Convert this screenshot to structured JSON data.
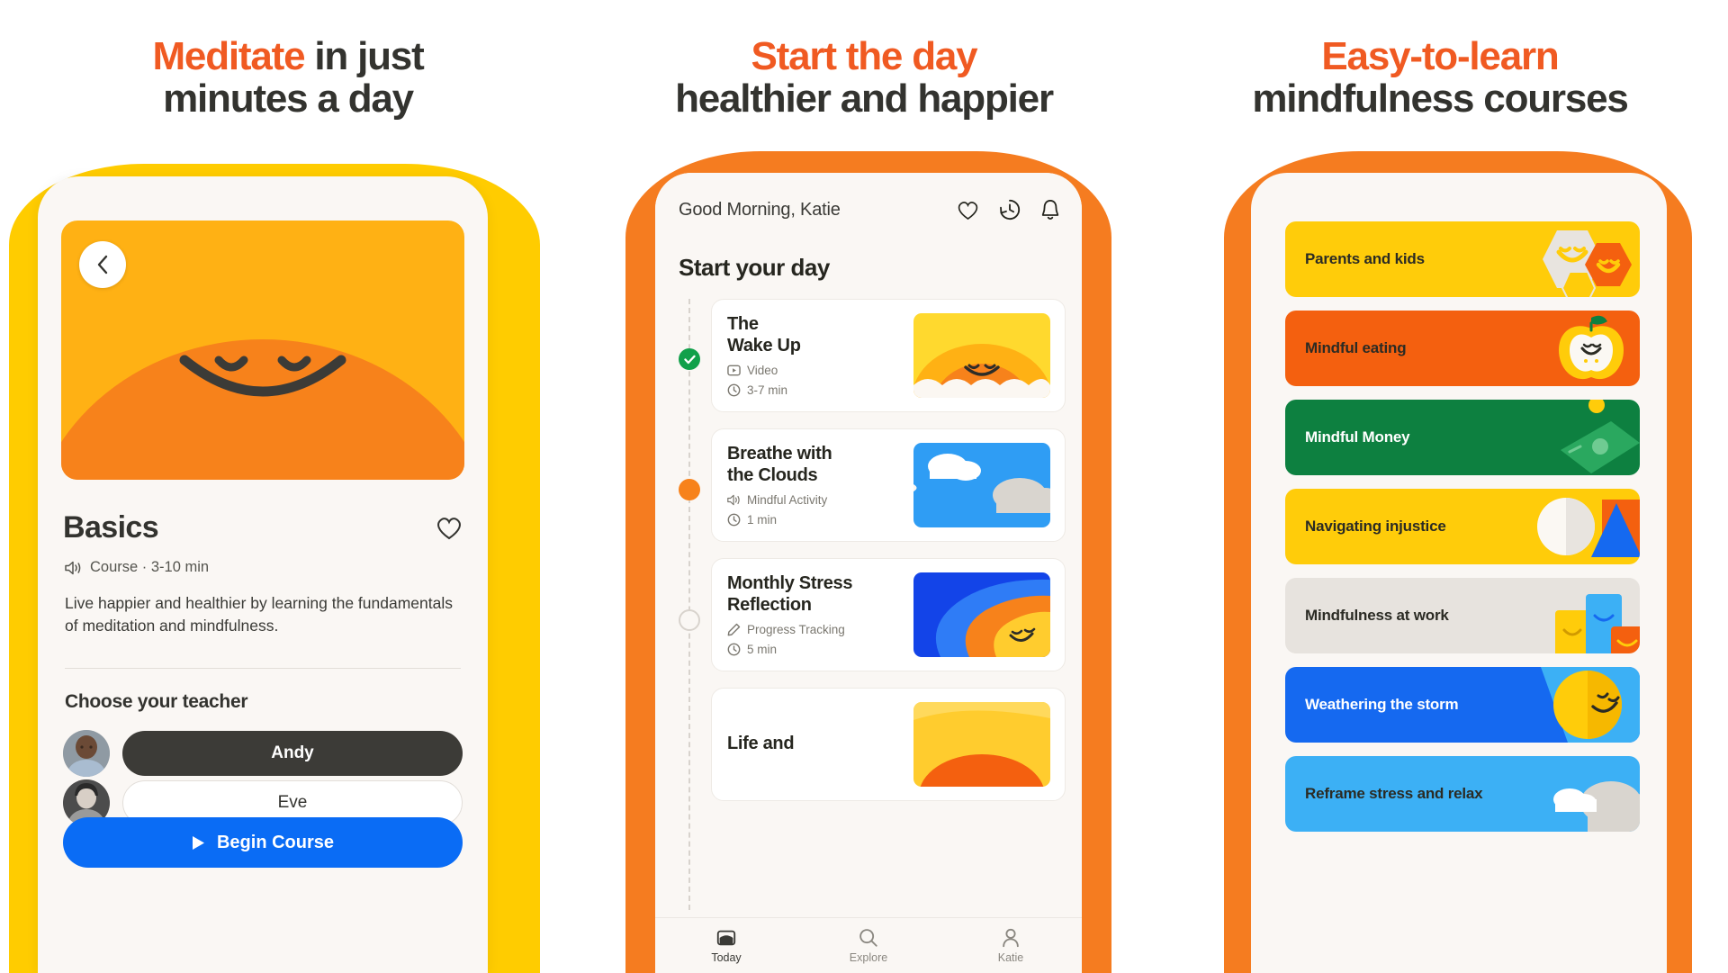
{
  "panels": [
    {
      "headline": {
        "accent": "Meditate",
        "rest": " in just",
        "line2": "minutes a day"
      },
      "app": {
        "back_icon": "chevron-left-icon",
        "course_title": "Basics",
        "favorite_icon": "heart-icon",
        "meta_icon": "speaker-icon",
        "meta": "Course · 3-10 min",
        "description": "Live happier and healthier by learning the fundamentals of meditation and mindfulness.",
        "teacher_heading": "Choose your teacher",
        "teachers": [
          {
            "name": "Andy",
            "selected": true
          },
          {
            "name": "Eve",
            "selected": false
          }
        ],
        "begin_label": "Begin Course",
        "begin_icon": "play-icon"
      }
    },
    {
      "headline": {
        "accent": "Start the day",
        "rest": "",
        "line2": "healthier and happier"
      },
      "app": {
        "greeting": "Good Morning, Katie",
        "header_icons": [
          "heart-icon",
          "history-icon",
          "bell-icon"
        ],
        "section_title": "Start your day",
        "cards": [
          {
            "title": "The\nWake Up",
            "type_icon": "video-icon",
            "type": "Video",
            "duration_icon": "clock-icon",
            "duration": "3-7 min",
            "state": "done",
            "art": "sunrise"
          },
          {
            "title": "Breathe with\nthe Clouds",
            "type_icon": "speaker-icon",
            "type": "Mindful Activity",
            "duration_icon": "clock-icon",
            "duration": "1 min",
            "state": "active",
            "art": "clouds"
          },
          {
            "title": "Monthly Stress\nReflection",
            "type_icon": "pencil-icon",
            "type": "Progress Tracking",
            "duration_icon": "clock-icon",
            "duration": "5 min",
            "state": "todo",
            "art": "waves"
          },
          {
            "title": "Life and",
            "type_icon": "",
            "type": "",
            "duration_icon": "",
            "duration": "",
            "state": "todo",
            "art": "sunrise2"
          }
        ],
        "tabs": [
          {
            "label": "Today",
            "icon": "today-icon",
            "active": true
          },
          {
            "label": "Explore",
            "icon": "search-icon",
            "active": false
          },
          {
            "label": "Katie",
            "icon": "person-icon",
            "active": false
          }
        ]
      }
    },
    {
      "headline": {
        "accent": "Easy-to-learn",
        "rest": "",
        "line2": "mindfulness courses"
      },
      "app": {
        "courses": [
          {
            "label": "Parents and kids",
            "bg": "#ffcc0a",
            "fg": "#2b2b24",
            "art": "parents"
          },
          {
            "label": "Mindful eating",
            "bg": "#f4600f",
            "fg": "#2b2b24",
            "art": "apple"
          },
          {
            "label": "Mindful Money",
            "bg": "#0d8040",
            "fg": "#ffffff",
            "art": "money"
          },
          {
            "label": "Navigating injustice",
            "bg": "#ffcc0a",
            "fg": "#2b2b24",
            "art": "shapes"
          },
          {
            "label": "Mindfulness at work",
            "bg": "#e7e3de",
            "fg": "#2b2b24",
            "art": "work"
          },
          {
            "label": "Weathering the storm",
            "bg": "#1569f0",
            "fg": "#ffffff",
            "art": "sun"
          },
          {
            "label": "Reframe stress and relax",
            "bg": "#3cb0f5",
            "fg": "#2b2b24",
            "art": "cloud"
          }
        ]
      }
    }
  ],
  "colors": {
    "accent_orange": "#f05a22",
    "headline_dark": "#33332f",
    "yellow": "#ffcc00",
    "orange": "#f57c20",
    "blue": "#0a6cf5",
    "green": "#11a04a"
  }
}
